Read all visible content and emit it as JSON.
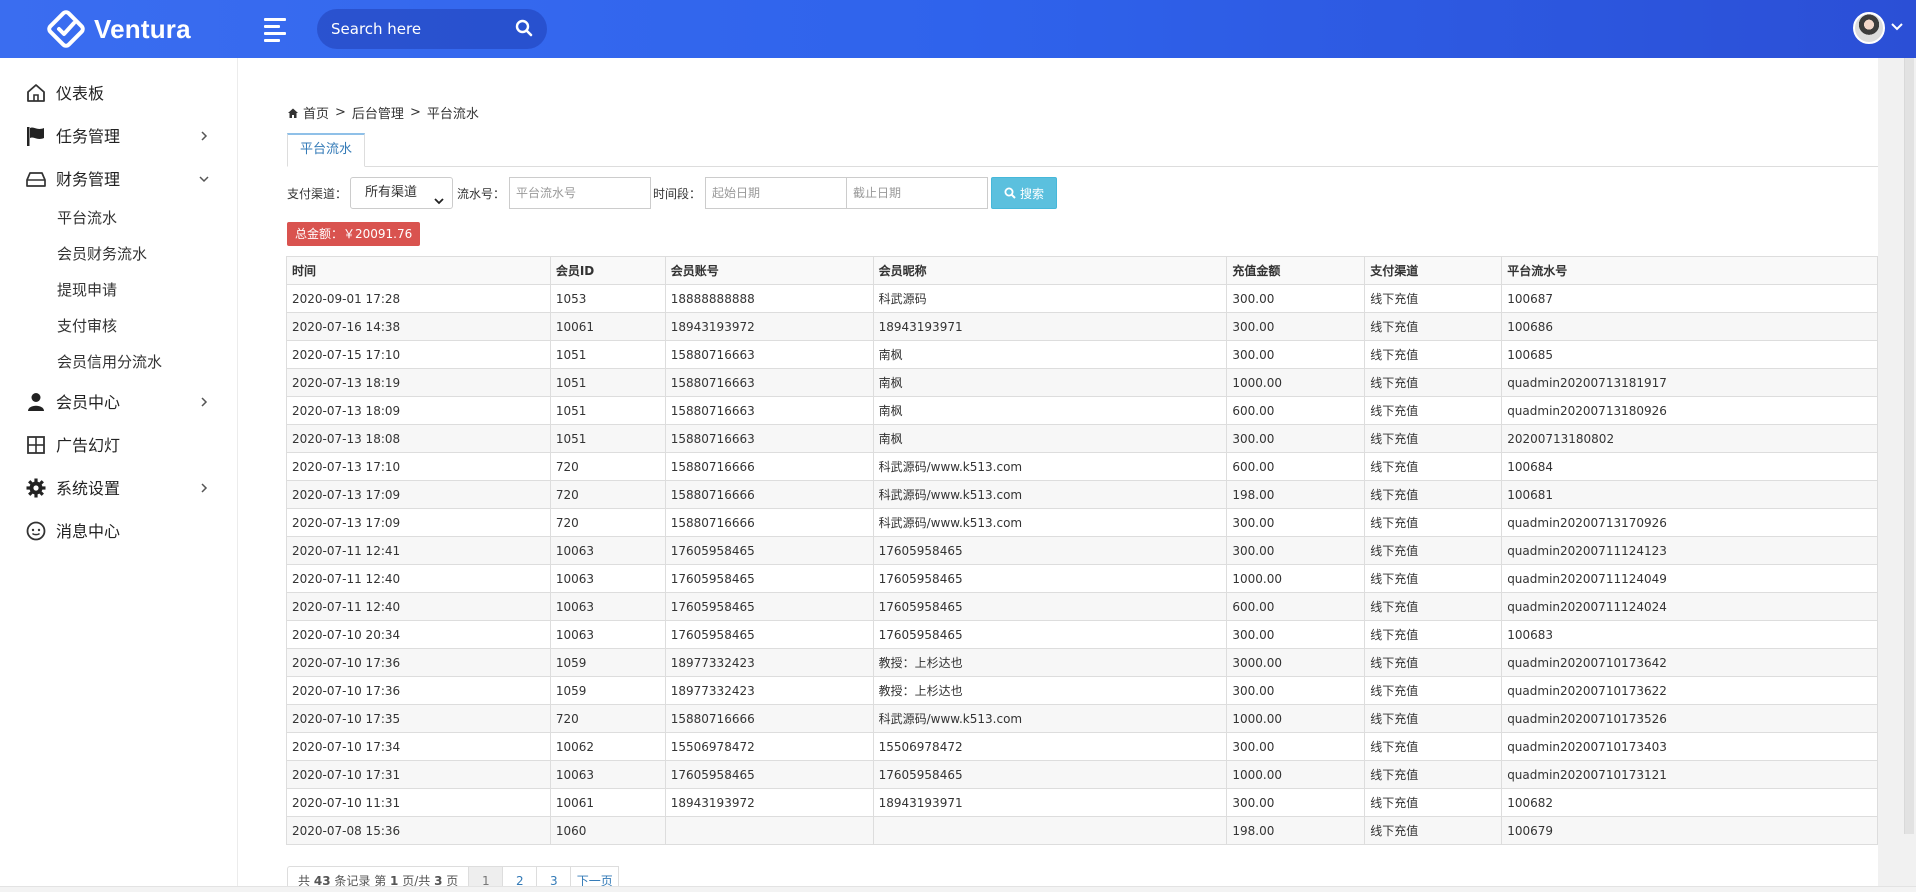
{
  "app": {
    "name": "Ventura",
    "search_placeholder": "Search here"
  },
  "sidebar": {
    "items": [
      {
        "label": "仪表板",
        "icon": "home-icon"
      },
      {
        "label": "任务管理",
        "icon": "flag-icon"
      },
      {
        "label": "财务管理",
        "icon": "tray-icon"
      },
      {
        "label": "会员中心",
        "icon": "user-icon"
      },
      {
        "label": "广告幻灯",
        "icon": "grid-icon"
      },
      {
        "label": "系统设置",
        "icon": "gear-icon"
      },
      {
        "label": "消息中心",
        "icon": "chat-icon"
      }
    ],
    "finance_sub": [
      "平台流水",
      "会员财务流水",
      "提现申请",
      "支付审核",
      "会员信用分流水"
    ]
  },
  "breadcrumb": [
    "首页",
    "后台管理",
    "平台流水"
  ],
  "tab": "平台流水",
  "filters": {
    "channel_label": "支付渠道：",
    "channel_value": "所有渠道",
    "serial_label": "流水号：",
    "serial_placeholder": "平台流水号",
    "period_label": "时间段：",
    "start_placeholder": "起始日期",
    "end_placeholder": "截止日期",
    "search_label": "搜索"
  },
  "total": "总金额：￥20091.76",
  "table": {
    "headers": [
      "时间",
      "会员ID",
      "会员账号",
      "会员昵称",
      "充值金额",
      "支付渠道",
      "平台流水号"
    ],
    "rows": [
      [
        "2020-09-01 17:28",
        "1053",
        "18888888888",
        "科武源码",
        "300.00",
        "线下充值",
        "100687"
      ],
      [
        "2020-07-16 14:38",
        "10061",
        "18943193972",
        "18943193971",
        "300.00",
        "线下充值",
        "100686"
      ],
      [
        "2020-07-15 17:10",
        "1051",
        "15880716663",
        "南枫",
        "300.00",
        "线下充值",
        "100685"
      ],
      [
        "2020-07-13 18:19",
        "1051",
        "15880716663",
        "南枫",
        "1000.00",
        "线下充值",
        "quadmin20200713181917"
      ],
      [
        "2020-07-13 18:09",
        "1051",
        "15880716663",
        "南枫",
        "600.00",
        "线下充值",
        "quadmin20200713180926"
      ],
      [
        "2020-07-13 18:08",
        "1051",
        "15880716663",
        "南枫",
        "300.00",
        "线下充值",
        "20200713180802"
      ],
      [
        "2020-07-13 17:10",
        "720",
        "15880716666",
        "科武源码/www.k513.com",
        "600.00",
        "线下充值",
        "100684"
      ],
      [
        "2020-07-13 17:09",
        "720",
        "15880716666",
        "科武源码/www.k513.com",
        "198.00",
        "线下充值",
        "100681"
      ],
      [
        "2020-07-13 17:09",
        "720",
        "15880716666",
        "科武源码/www.k513.com",
        "300.00",
        "线下充值",
        "quadmin20200713170926"
      ],
      [
        "2020-07-11 12:41",
        "10063",
        "17605958465",
        "17605958465",
        "300.00",
        "线下充值",
        "quadmin20200711124123"
      ],
      [
        "2020-07-11 12:40",
        "10063",
        "17605958465",
        "17605958465",
        "1000.00",
        "线下充值",
        "quadmin20200711124049"
      ],
      [
        "2020-07-11 12:40",
        "10063",
        "17605958465",
        "17605958465",
        "600.00",
        "线下充值",
        "quadmin20200711124024"
      ],
      [
        "2020-07-10 20:34",
        "10063",
        "17605958465",
        "17605958465",
        "300.00",
        "线下充值",
        "100683"
      ],
      [
        "2020-07-10 17:36",
        "1059",
        "18977332423",
        "教授：上杉达也",
        "3000.00",
        "线下充值",
        "quadmin20200710173642"
      ],
      [
        "2020-07-10 17:36",
        "1059",
        "18977332423",
        "教授：上杉达也",
        "300.00",
        "线下充值",
        "quadmin20200710173622"
      ],
      [
        "2020-07-10 17:35",
        "720",
        "15880716666",
        "科武源码/www.k513.com",
        "1000.00",
        "线下充值",
        "quadmin20200710173526"
      ],
      [
        "2020-07-10 17:34",
        "10062",
        "15506978472",
        "15506978472",
        "300.00",
        "线下充值",
        "quadmin20200710173403"
      ],
      [
        "2020-07-10 17:31",
        "10063",
        "17605958465",
        "17605958465",
        "1000.00",
        "线下充值",
        "quadmin20200710173121"
      ],
      [
        "2020-07-10 11:31",
        "10061",
        "18943193972",
        "18943193971",
        "300.00",
        "线下充值",
        "100682"
      ],
      [
        "2020-07-08 15:36",
        "1060",
        "",
        "",
        "198.00",
        "线下充值",
        "100679"
      ]
    ]
  },
  "pagination": {
    "info_prefix": "共",
    "total_records": "43",
    "info_mid": "条记录 第",
    "current_page": "1",
    "info_mid2": "页/共",
    "total_pages": "3",
    "info_suffix": "页",
    "pages": [
      "1",
      "2",
      "3"
    ],
    "next_label": "下一页"
  }
}
